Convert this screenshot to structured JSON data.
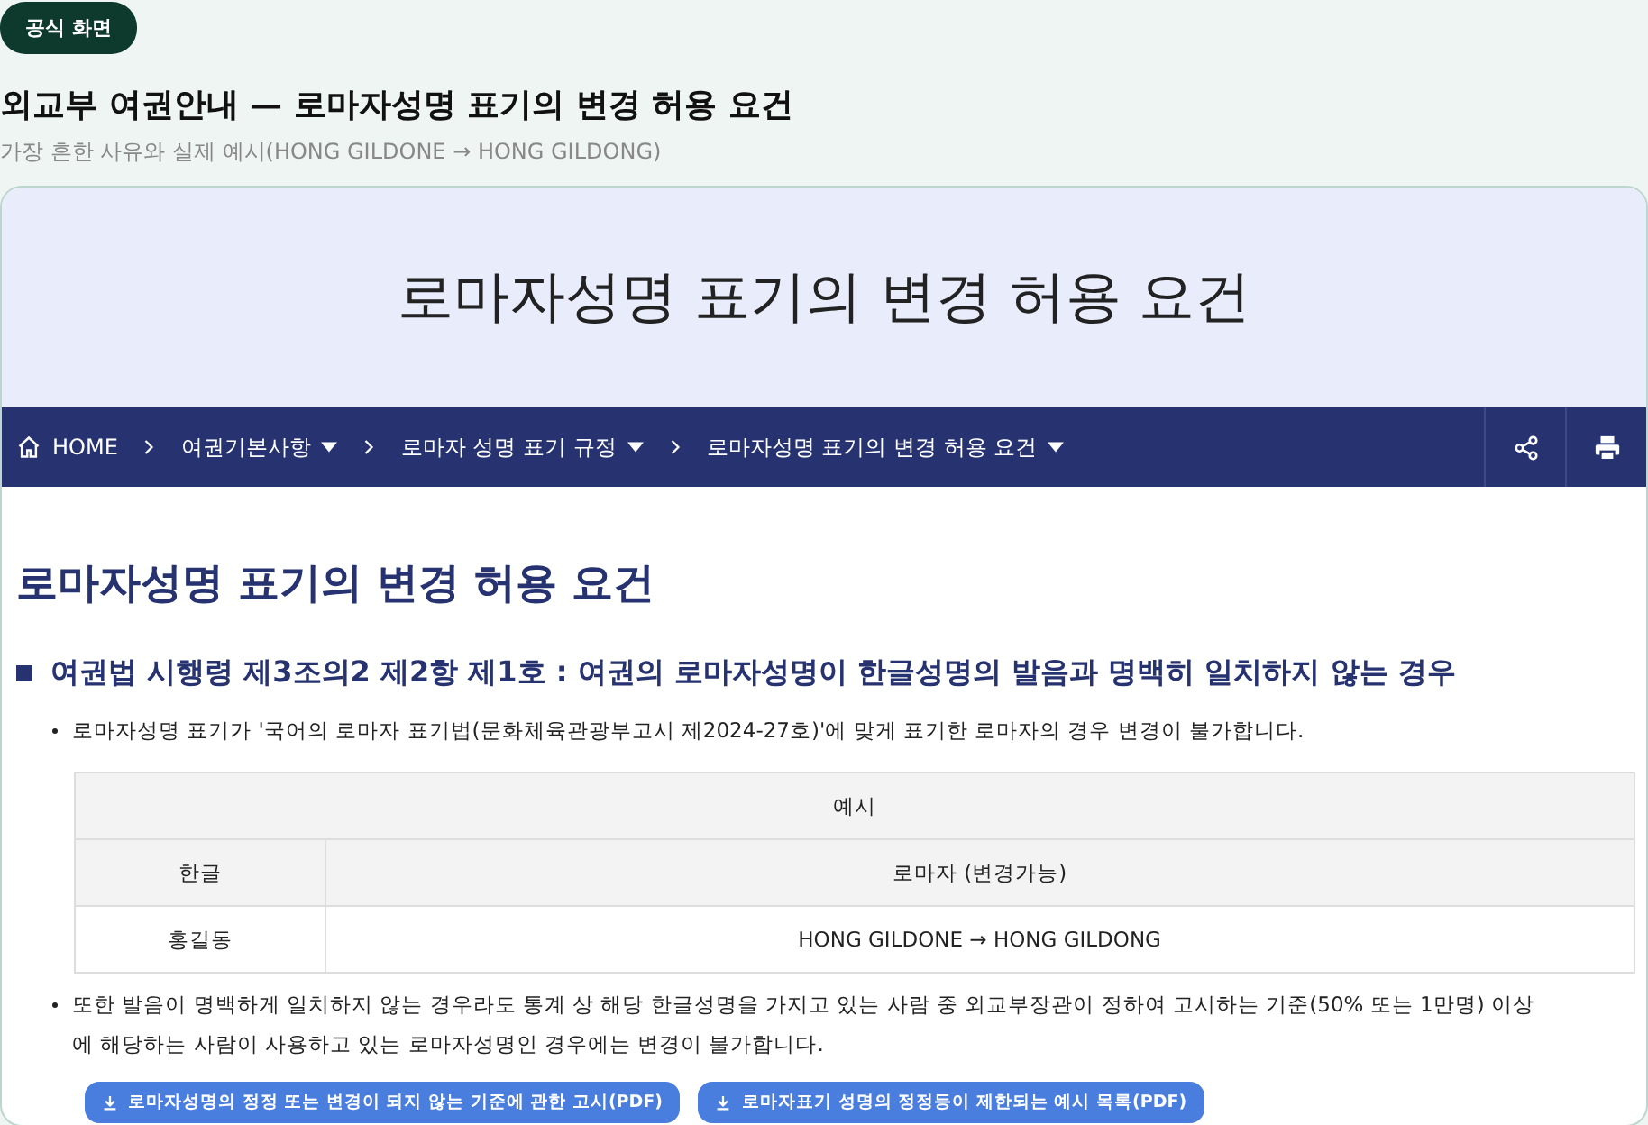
{
  "badge": "공식 화면",
  "page_title": "외교부 여권안내 — 로마자성명 표기의 변경 허용 요건",
  "subtitle": "가장 흔한 사유와 실제 예시(HONG GILDONE → HONG GILDONG)",
  "hero_title": "로마자성명 표기의 변경 허용 요건",
  "breadcrumb": [
    {
      "label": "HOME",
      "kind": "home",
      "dropdown": false
    },
    {
      "label": "여권기본사항",
      "kind": "link",
      "dropdown": true
    },
    {
      "label": "로마자 성명 표기 규정",
      "kind": "link",
      "dropdown": true
    },
    {
      "label": "로마자성명 표기의 변경 허용 요건",
      "kind": "link",
      "dropdown": true
    }
  ],
  "nav_actions": [
    {
      "kind": "share"
    },
    {
      "kind": "print"
    }
  ],
  "heading": "로마자성명 표기의 변경 허용 요건",
  "section_title": "여권법 시행령 제3조의2 제2항 제1호 : 여권의 로마자성명이 한글성명의 발음과 명백히 일치하지 않는 경우",
  "bullet_1": "로마자성명 표기가 '국어의 로마자 표기법(문화체육관광부고시 제2024-27호)'에 맞게 표기한 로마자의 경우 변경이 불가합니다.",
  "table": {
    "caption": "예시",
    "columns": [
      "한글",
      "로마자 (변경가능)"
    ],
    "rows": [
      [
        "홍길동",
        "HONG GILDONE → HONG GILDONG"
      ]
    ]
  },
  "bullet_2": "또한 발음이 명백하게 일치하지 않는 경우라도 통계 상 해당 한글성명을 가지고 있는 사람 중 외교부장관이 정하여 고시하는 기준(50% 또는 1만명) 이상에 해당하는 사람이 사용하고 있는 로마자성명인 경우에는 변경이 불가합니다.",
  "downloads": [
    "로마자성명의 정정 또는 변경이 되지 않는 기준에 관한 고시(PDF)",
    "로마자표기 성명의 정정등이 제한되는 예시 목록(PDF)"
  ]
}
